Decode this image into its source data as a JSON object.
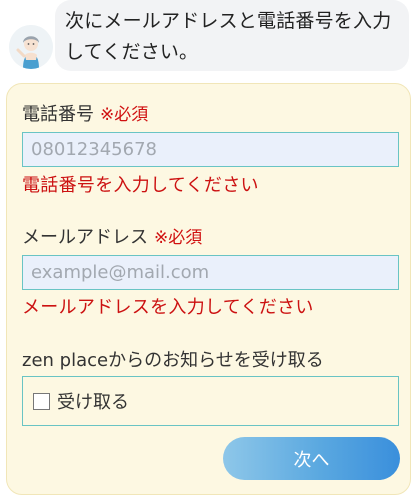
{
  "assistant": {
    "message": "次にメールアドレスと電話番号を入力してください。"
  },
  "form": {
    "phone": {
      "label": "電話番号",
      "required": "※必須",
      "placeholder": "08012345678",
      "error": "電話番号を入力してください"
    },
    "email": {
      "label": "メールアドレス",
      "required": "※必須",
      "placeholder": "example@mail.com",
      "error": "メールアドレスを入力してください"
    },
    "newsletter": {
      "label": "zen placeからのお知らせを受け取る",
      "checkbox_label": "受け取る",
      "checked": false
    },
    "next_label": "次へ"
  },
  "colors": {
    "error": "#cc1111",
    "input_border": "#69c4c4",
    "card_background": "#fdf8e2",
    "button_gradient_start": "#8ec7e9",
    "button_gradient_end": "#3a8fdc"
  }
}
